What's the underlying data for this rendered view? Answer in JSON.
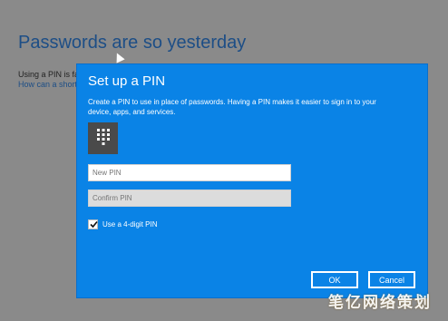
{
  "background": {
    "title": "Passwords are so yesterday",
    "text": "Using a PIN is fa",
    "link": "How can a short"
  },
  "dialog": {
    "title": "Set up a PIN",
    "description": "Create a PIN to use in place of passwords. Having a PIN makes it easier to sign in to your device, apps, and services.",
    "icon": "keypad-icon",
    "new_pin_placeholder": "New PIN",
    "confirm_pin_placeholder": "Confirm PIN",
    "checkbox_label": "Use a 4-digit PIN",
    "checkbox_checked": true,
    "ok_label": "OK",
    "cancel_label": "Cancel",
    "accent_color": "#0a83e6"
  },
  "watermark": "笔亿网络策划"
}
